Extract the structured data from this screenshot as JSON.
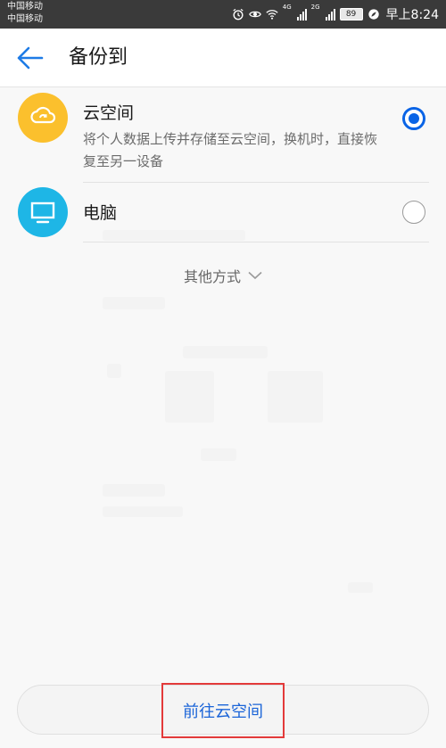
{
  "status_bar": {
    "carrier_1": "中国移动",
    "carrier_2": "中国移动",
    "sim1_network": "4G",
    "sim2_network": "2G",
    "battery": "89",
    "time": "早上8:24",
    "icons": [
      "alarm-icon",
      "eye-icon",
      "wifi-icon",
      "signal-icon",
      "signal-icon",
      "battery-icon",
      "leaf-icon"
    ]
  },
  "app_bar": {
    "title": "备份到",
    "back_icon": "back-arrow-icon"
  },
  "options": [
    {
      "title": "云空间",
      "description": "将个人数据上传并存储至云空间，换机时，直接恢复至另一设备",
      "icon": "cloud-sync-icon",
      "icon_color": "#FBC02D",
      "selected": true
    },
    {
      "title": "电脑",
      "description": "",
      "icon": "monitor-icon",
      "icon_color": "#1EB6E6",
      "selected": false
    }
  ],
  "more": {
    "label": "其他方式",
    "icon": "chevron-down-icon"
  },
  "footer": {
    "button_label": "前往云空间"
  },
  "colors": {
    "accent": "#0A64E6",
    "highlight_box": "#E33A3A"
  }
}
